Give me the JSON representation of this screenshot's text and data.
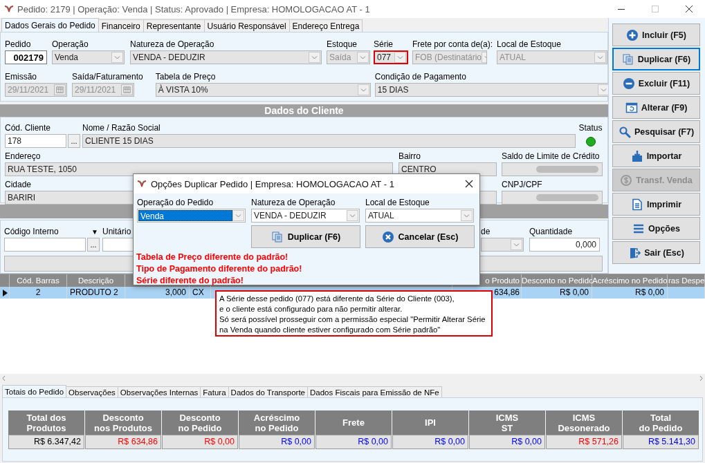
{
  "window": {
    "title": "Pedido: 2179 | Operação: Venda | Status: Aprovado | Empresa: HOMOLOGACAO AT - 1"
  },
  "tabs": [
    {
      "label": "Dados Gerais do Pedido",
      "selected": true
    },
    {
      "label": "Financeiro",
      "selected": false
    },
    {
      "label": "Representante",
      "selected": false
    },
    {
      "label": "Usuário Responsável",
      "selected": false
    },
    {
      "label": "Endereço Entrega",
      "selected": false
    }
  ],
  "order_fields": [
    [
      {
        "label": "Pedido",
        "value": "002179",
        "kind": "id",
        "disabled": false,
        "highlighted": false
      },
      {
        "label": "Operação",
        "value": "Venda",
        "kind": "select",
        "disabled": false,
        "highlighted": false
      },
      {
        "label": "Natureza de Operação",
        "value": "VENDA - DEDUZIR",
        "kind": "select",
        "disabled": false,
        "highlighted": false
      },
      {
        "label": "Estoque",
        "value": "Saída",
        "kind": "select",
        "disabled": true,
        "highlighted": false
      },
      {
        "label": "Série",
        "value": "077",
        "kind": "select",
        "disabled": false,
        "highlighted": true
      },
      {
        "label": "Frete por conta de(a):",
        "value": "FOB (Destinatário",
        "kind": "select",
        "disabled": true,
        "highlighted": false
      },
      {
        "label": "Local de Estoque",
        "value": "ATUAL",
        "kind": "select",
        "disabled": true,
        "highlighted": false
      }
    ],
    [
      {
        "label": "Emissão",
        "value": "29/11/2021",
        "kind": "date",
        "disabled": true,
        "highlighted": false
      },
      {
        "label": "Saída/Faturamento",
        "value": "29/11/2021",
        "kind": "date",
        "disabled": true,
        "highlighted": false
      },
      {
        "label": "Tabela de Preço",
        "value": "À VISTA 10%",
        "kind": "select",
        "disabled": false,
        "highlighted": false
      },
      {
        "label": "Condição de Pagamento",
        "value": "15 DIAS",
        "kind": "select",
        "disabled": false,
        "highlighted": false
      }
    ]
  ],
  "client": {
    "title": "Dados do Cliente",
    "rows": [
      [
        {
          "label": "Cód. Cliente",
          "value": "178",
          "kind": "input",
          "button": "..."
        },
        {
          "label": "Nome / Razão Social",
          "value": "CLIENTE 15 DIAS",
          "kind": "readonly"
        },
        {
          "label": "Status",
          "kind": "status",
          "color": "#1fae1f"
        }
      ],
      [
        {
          "label": "Endereço",
          "value": "RUA TESTE, 1050",
          "kind": "readonly"
        },
        {
          "label": "Bairro",
          "value": "CENTRO",
          "kind": "readonly"
        },
        {
          "label": "Saldo de Limite de Crédito",
          "kind": "redacted"
        }
      ],
      [
        {
          "label": "Cidade",
          "value": "BARIRI",
          "kind": "readonly"
        },
        {
          "kind": "readonly"
        },
        {
          "label": "CNPJ/CPF",
          "kind": "redacted"
        }
      ]
    ]
  },
  "item_entry": [
    {
      "label": "Código Interno",
      "label_icon": "▼",
      "kind": "input",
      "button": "..."
    },
    {
      "label": "Unitário",
      "kind": "input"
    },
    {
      "label": "de",
      "kind": "select"
    },
    {
      "label": "Quantidade",
      "value": "0,000",
      "kind": "number"
    }
  ],
  "actions": [
    {
      "label": "Incluir (F5)",
      "kind": "plus",
      "selected": false,
      "disabled": false
    },
    {
      "label": "Duplicar (F6)",
      "kind": "copy",
      "selected": true,
      "disabled": false
    },
    {
      "label": "Excluir (F11)",
      "kind": "minus",
      "selected": false,
      "disabled": false
    },
    {
      "label": "Alterar (F9)",
      "kind": "window",
      "selected": false,
      "disabled": false
    },
    {
      "label": "Pesquisar (F7)",
      "kind": "search",
      "selected": false,
      "disabled": false
    },
    {
      "label": "Importar",
      "kind": "import",
      "selected": false,
      "disabled": false
    },
    {
      "label": "Transf. Venda",
      "kind": "money",
      "selected": false,
      "disabled": true
    },
    {
      "label": "Imprimir",
      "kind": "document",
      "selected": false,
      "disabled": false
    },
    {
      "label": "Opções",
      "kind": "menu",
      "selected": false,
      "disabled": false
    },
    {
      "label": "Sair (Esc)",
      "kind": "exit",
      "selected": false,
      "disabled": false
    }
  ],
  "grid": {
    "columns": [
      "Cód. Barras",
      "Descrição",
      "",
      "",
      "",
      "o Produto",
      "Desconto no Pedido",
      "Acréscimo no Pedido",
      "ras Despe"
    ],
    "rows": [
      {
        "selected": true,
        "cells": [
          "2",
          "PRODUTO 2",
          "3,000",
          "CX",
          "",
          "634,86",
          "R$ 0,00",
          "R$ 0,00",
          ""
        ]
      }
    ]
  },
  "bottom_tabs": [
    {
      "label": "Totais do Pedido",
      "selected": true
    },
    {
      "label": "Observações",
      "selected": false
    },
    {
      "label": "Observações Internas",
      "selected": false
    },
    {
      "label": "Fatura",
      "selected": false
    },
    {
      "label": "Dados do Transporte",
      "selected": false
    },
    {
      "label": "Dados Fiscais para Emissão de NFe",
      "selected": false
    }
  ],
  "totals": [
    {
      "label": "Total dos\nProdutos",
      "value": "R$ 6.347,42",
      "color": "#000000"
    },
    {
      "label": "Desconto\nnos Produtos",
      "value": "R$ 634,86",
      "color": "#ff0000"
    },
    {
      "label": "Desconto\nno Pedido",
      "value": "R$ 0,00",
      "color": "#ff0000"
    },
    {
      "label": "Acréscimo\nno Pedido",
      "value": "R$ 0,00",
      "color": "#0000ff"
    },
    {
      "label": "Frete",
      "value": "R$ 0,00",
      "color": "#0000ff"
    },
    {
      "label": "IPI",
      "value": "R$ 0,00",
      "color": "#0000ff"
    },
    {
      "label": "ICMS\nST",
      "value": "R$ 0,00",
      "color": "#0000ff"
    },
    {
      "label": "ICMS\nDesonerado",
      "value": "R$ 571,26",
      "color": "#ff0000"
    },
    {
      "label": "Total\ndo Pedido",
      "value": "R$ 5.141,30",
      "color": "#0000ff"
    }
  ],
  "dialog": {
    "title": "Opções Duplicar Pedido | Empresa: HOMOLOGACAO AT - 1",
    "fields": [
      {
        "label": "Operação do Pedido",
        "value": "Venda",
        "selected": true
      },
      {
        "label": "Natureza de Operação",
        "value": "VENDA - DEDUZIR",
        "selected": false
      },
      {
        "label": "Local de Estoque",
        "value": "ATUAL",
        "selected": false
      }
    ],
    "buttons": [
      {
        "label": "Duplicar (F6)",
        "kind": "copy"
      },
      {
        "label": "Cancelar (Esc)",
        "kind": "cancel"
      }
    ],
    "warnings": [
      "Tabela de Preço diferente do padrão!",
      "Tipo de Pagamento diferente do padrão!",
      "Série diferente do padrão!"
    ]
  },
  "tooltip": {
    "lines": [
      "A Série desse pedido (077) está diferente da Série do Cliente (003),",
      "e o cliente está configurado para não permitir alterar.",
      "Só será possível prosseguir com a permissão especial \"Permitir Alterar Série",
      "na Venda quando cliente estiver configurado com Série padrão\""
    ]
  }
}
